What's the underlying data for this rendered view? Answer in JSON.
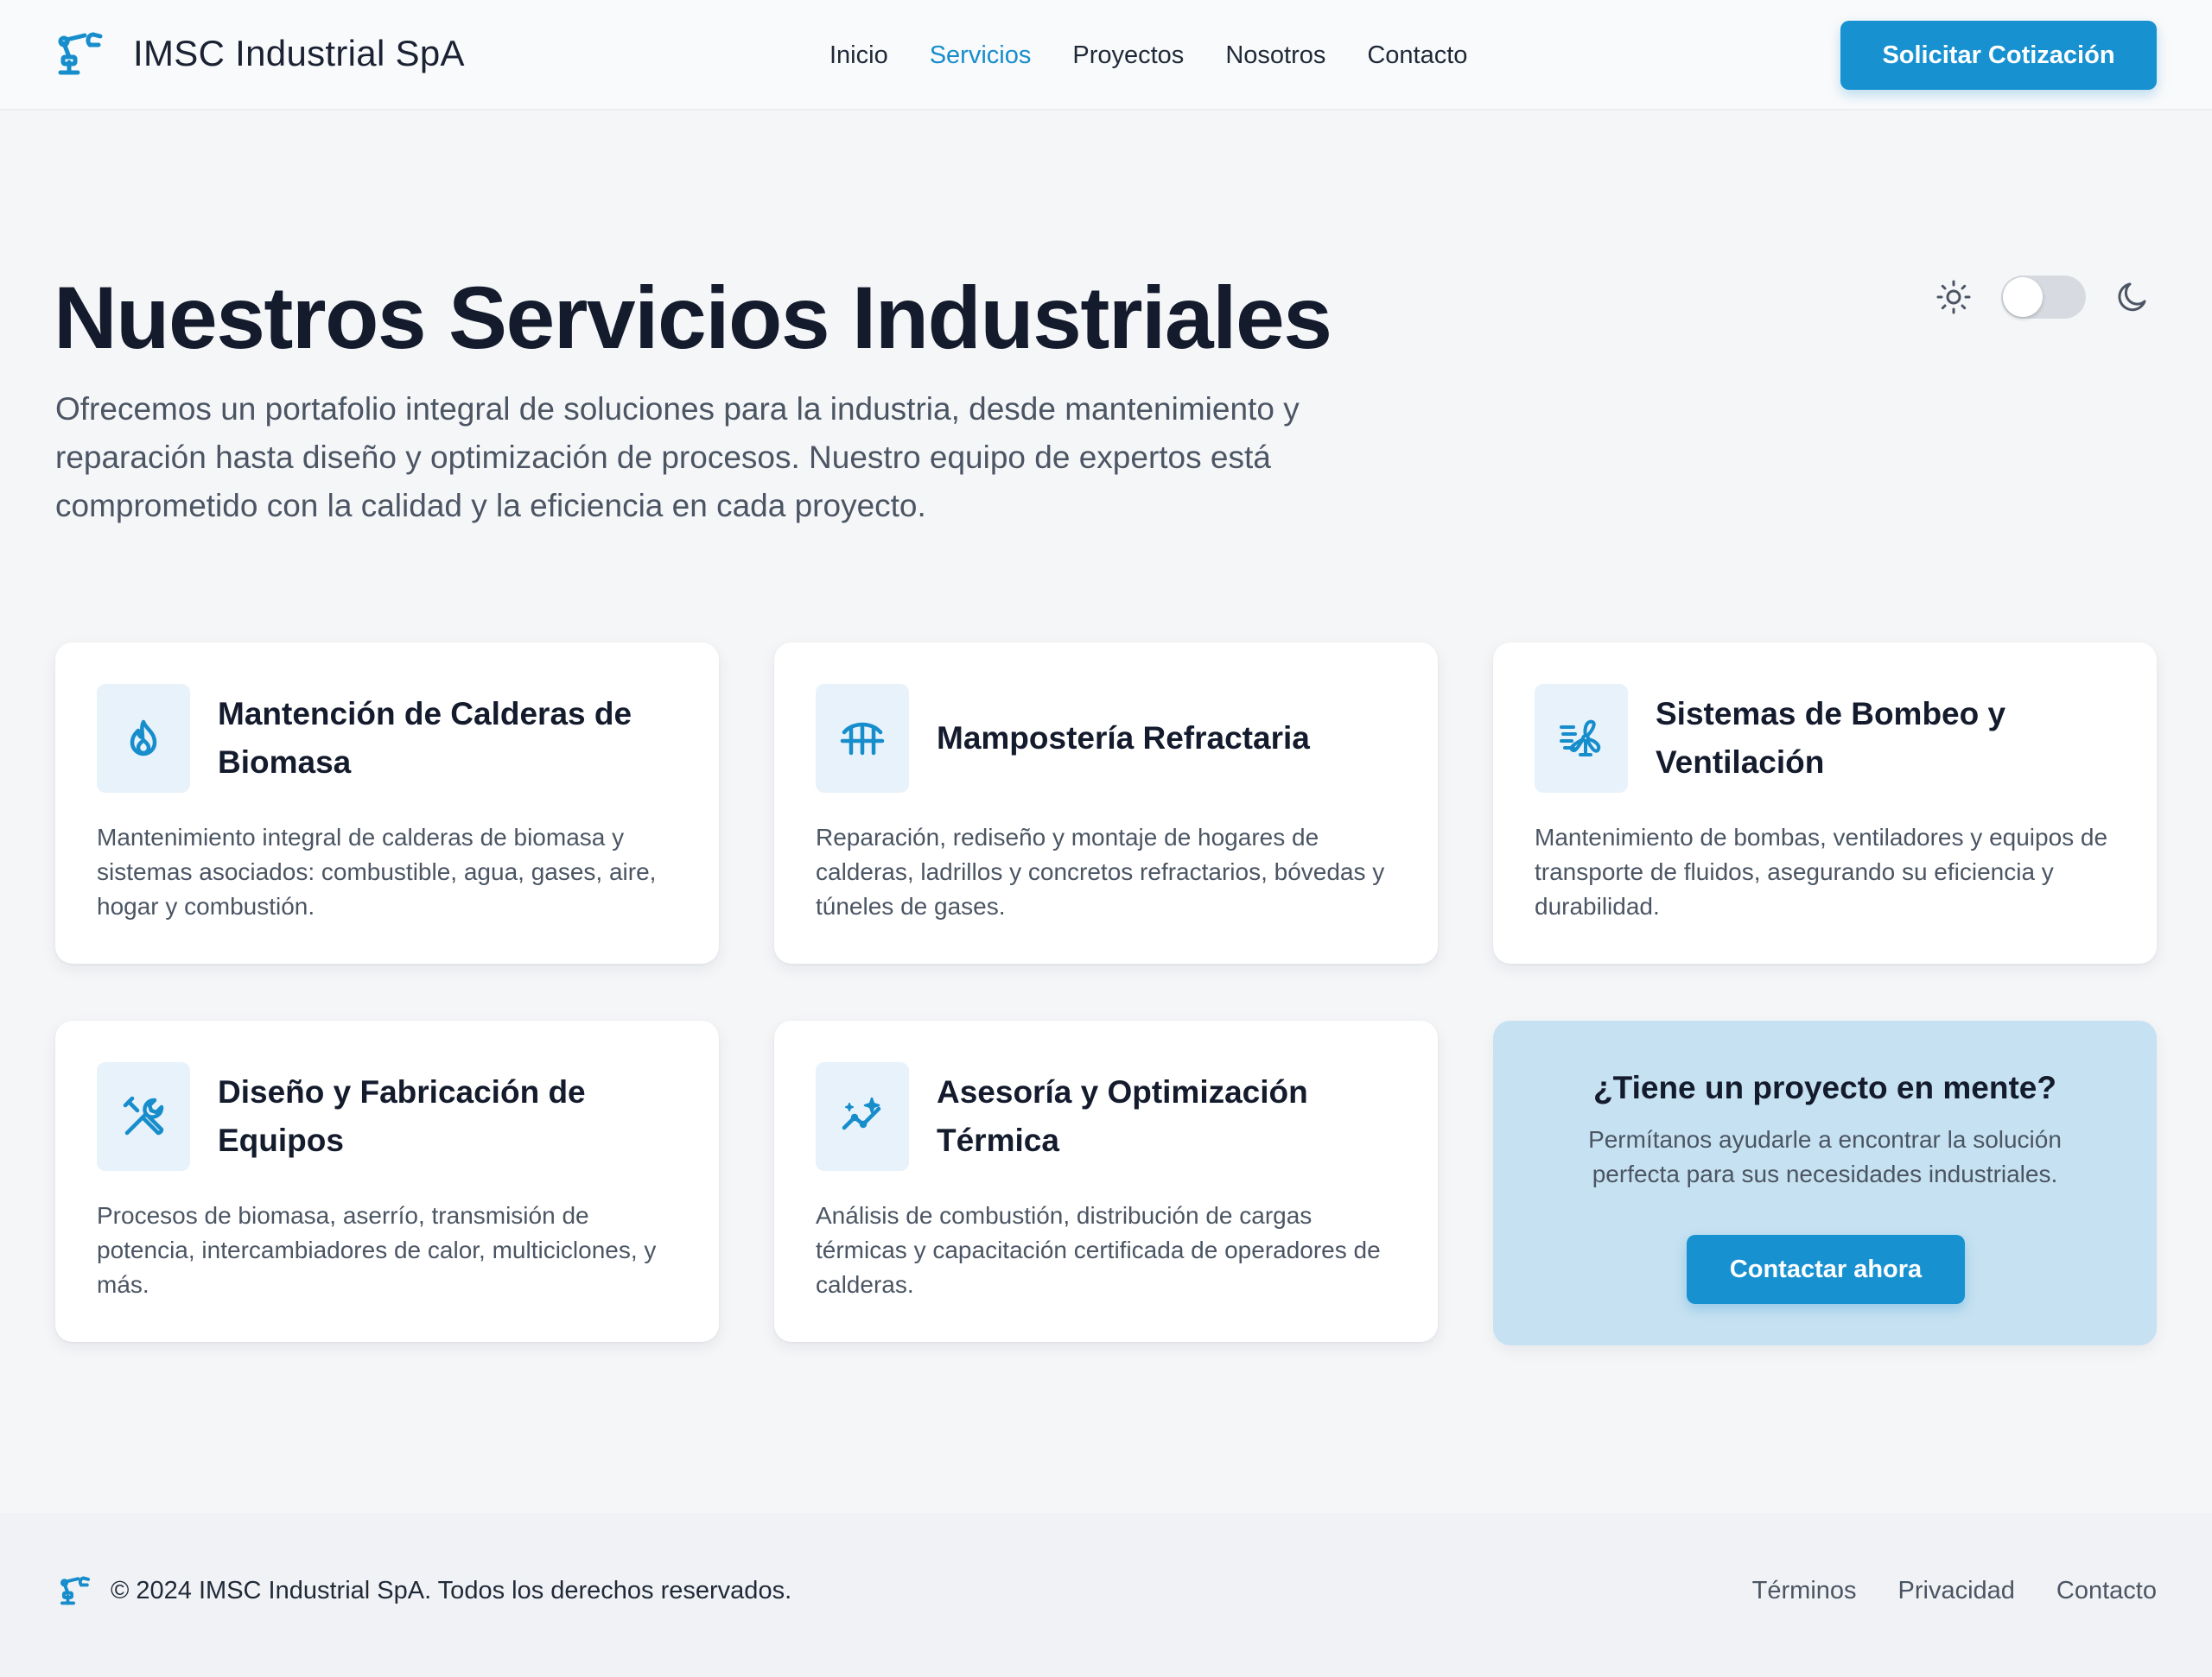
{
  "header": {
    "brand_name": "IMSC Industrial SpA",
    "brand_icon": "robot-arm-icon",
    "nav": [
      {
        "label": "Inicio",
        "active": false
      },
      {
        "label": "Servicios",
        "active": true
      },
      {
        "label": "Proyectos",
        "active": false
      },
      {
        "label": "Nosotros",
        "active": false
      },
      {
        "label": "Contacto",
        "active": false
      }
    ],
    "quote_button": "Solicitar Cotización"
  },
  "hero": {
    "title": "Nuestros Servicios Industriales",
    "description": "Ofrecemos un portafolio integral de soluciones para la industria, desde mantenimiento y reparación hasta diseño y optimización de procesos. Nuestro equipo de expertos está comprometido con la calidad y la eficiencia en cada proyecto."
  },
  "theme_toggle": {
    "light_icon": "sun-icon",
    "dark_icon": "moon-icon",
    "mode": "light"
  },
  "services": [
    {
      "icon": "flame-icon",
      "title": "Mantención de Calderas de Biomasa",
      "description": "Mantenimiento integral de calderas de biomasa y sistemas asociados: combustible, agua, gases, aire, hogar y combustión."
    },
    {
      "icon": "bridge-icon",
      "title": "Mampostería Refractaria",
      "description": "Reparación, rediseño y montaje de hogares de calderas, ladrillos y concretos refractarios, bóvedas y túneles de gases."
    },
    {
      "icon": "fan-icon",
      "title": "Sistemas de Bombeo y Ventilación",
      "description": "Mantenimiento de bombas, ventiladores y equipos de transporte de fluidos, asegurando su eficiencia y durabilidad."
    },
    {
      "icon": "tools-icon",
      "title": "Diseño y Fabricación de Equipos",
      "description": "Procesos de biomasa, aserrío, transmisión de potencia, intercambiadores de calor, multiciclones, y más."
    },
    {
      "icon": "chart-sparkle-icon",
      "title": "Asesoría y Optimización Térmica",
      "description": "Análisis de combustión, distribución de cargas térmicas y capacitación certificada de operadores de calderas."
    }
  ],
  "cta": {
    "title": "¿Tiene un proyecto en mente?",
    "text": "Permítanos ayudarle a encontrar la solución perfecta para sus necesidades industriales.",
    "button": "Contactar ahora"
  },
  "footer": {
    "copyright": "© 2024 IMSC Industrial SpA. Todos los derechos reservados.",
    "links": [
      "Términos",
      "Privacidad",
      "Contacto"
    ]
  },
  "colors": {
    "accent": "#1891d1",
    "cta_background": "#c6e1f1",
    "icon_background": "#e7f2fb"
  }
}
